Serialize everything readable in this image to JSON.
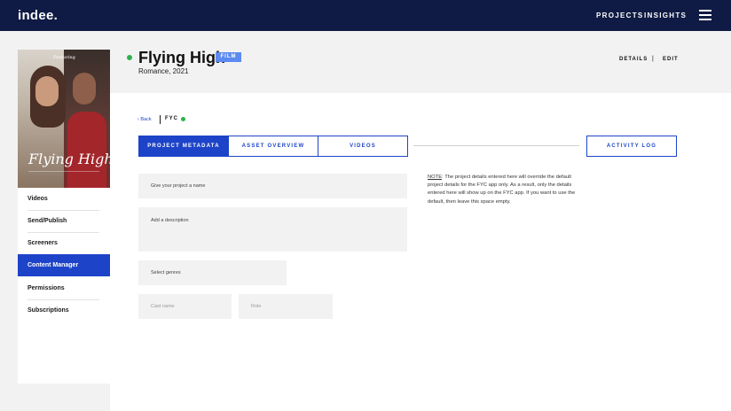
{
  "topbar": {
    "logo": "indee.",
    "nav": [
      "PROJECTS",
      "INSIGHTS"
    ],
    "menu_icon": "hamburger-menu-icon"
  },
  "poster": {
    "featuring": "Featuring",
    "title": "Flying High"
  },
  "project": {
    "title": "Flying High",
    "badge": "FILM",
    "subtitle": "Romance, 2021",
    "status_color": "#2bb24c"
  },
  "header_actions": {
    "details": "DETAILS",
    "separator": "|",
    "edit": "EDIT"
  },
  "sidebar": {
    "items": [
      {
        "label": "Videos",
        "active": false
      },
      {
        "label": "Send/Publish",
        "active": false
      },
      {
        "label": "Screeners",
        "active": false
      },
      {
        "label": "Content Manager",
        "active": true
      },
      {
        "label": "Permissions",
        "active": false
      },
      {
        "label": "Subscriptions",
        "active": false
      }
    ]
  },
  "breadcrumb": {
    "back": "Back",
    "back_icon": "chevron-left-icon",
    "current": "FYC"
  },
  "tabs": [
    {
      "label": "PROJECT METADATA",
      "active": true
    },
    {
      "label": "ASSET OVERVIEW",
      "active": false
    },
    {
      "label": "VIDEOS",
      "active": false
    }
  ],
  "activity_log": "ACTIVITY LOG",
  "form": {
    "name_placeholder": "Give your project a name",
    "description_placeholder": "Add a description",
    "genres_placeholder": "Select genres",
    "cast_placeholder": "Cast name",
    "role_placeholder": "Role"
  },
  "note": {
    "label": "NOTE",
    "text": ": The project details entered here will override the default project details for the FYC app only. As a result, only the details entered here will show up on the FYC app. If you want to use the default, then leave this space empty."
  },
  "colors": {
    "navy": "#0f1b44",
    "accent": "#1d44c8",
    "badge": "#5c8af0",
    "status": "#2bb24c"
  }
}
